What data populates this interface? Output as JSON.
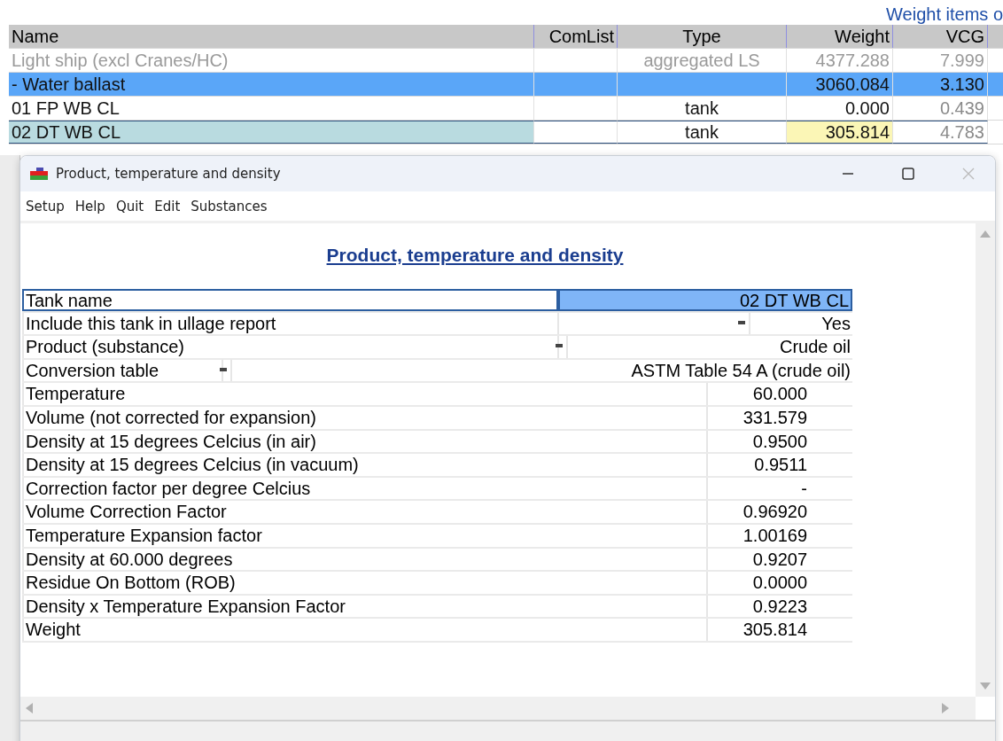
{
  "background": {
    "caption": "Weight items o",
    "columns": [
      "Name",
      "ComList",
      "Type",
      "Weight",
      "VCG"
    ],
    "rows": [
      {
        "kind": "aggregate",
        "selected": false,
        "cells": [
          "Light ship (excl Cranes/HC)",
          "",
          "aggregated LS",
          "4377.288",
          "7.999"
        ]
      },
      {
        "kind": "group",
        "selected": false,
        "cells": [
          "- Water ballast",
          "",
          "",
          "3060.084",
          "3.130"
        ]
      },
      {
        "kind": "item",
        "selected": false,
        "cells": [
          "01 FP WB  CL",
          "",
          "tank",
          "0.000",
          "0.439"
        ]
      },
      {
        "kind": "item",
        "selected": true,
        "cells": [
          "02 DT WB CL",
          "",
          "tank",
          "305.814",
          "4.783"
        ]
      }
    ]
  },
  "dialog": {
    "title": "Product, temperature and density",
    "menu": [
      "Setup",
      "Help",
      "Quit",
      "Edit",
      "Substances"
    ],
    "heading": "Product, temperature and density",
    "rows": [
      {
        "kind": "name",
        "selected": true,
        "dropdown": false,
        "label": "Tank name",
        "value": "02 DT WB CL"
      },
      {
        "kind": "choice",
        "selected": false,
        "dropdown": true,
        "label": "Include this tank in ullage report",
        "value": "Yes"
      },
      {
        "kind": "medium",
        "selected": false,
        "dropdown": true,
        "label": "Product (substance)",
        "value": "Crude oil"
      },
      {
        "kind": "wide",
        "selected": false,
        "dropdown": true,
        "label": "Conversion table",
        "value": "ASTM Table 54 A (crude oil)"
      },
      {
        "kind": "number",
        "selected": false,
        "dropdown": false,
        "label": "Temperature",
        "value": "60.000"
      },
      {
        "kind": "number",
        "selected": false,
        "dropdown": false,
        "label": "Volume (not corrected for expansion)",
        "value": "331.579"
      },
      {
        "kind": "number",
        "selected": false,
        "dropdown": false,
        "label": "Density at 15 degrees Celcius (in air)",
        "value": "0.9500"
      },
      {
        "kind": "number",
        "selected": false,
        "dropdown": false,
        "label": "Density at 15 degrees Celcius (in vacuum)",
        "value": "0.9511"
      },
      {
        "kind": "number",
        "selected": false,
        "dropdown": false,
        "label": "Correction factor per degree Celcius",
        "value": "-"
      },
      {
        "kind": "number",
        "selected": false,
        "dropdown": false,
        "label": "Volume Correction Factor",
        "value": "0.96920"
      },
      {
        "kind": "number",
        "selected": false,
        "dropdown": false,
        "label": "Temperature Expansion factor",
        "value": "1.00169"
      },
      {
        "kind": "number",
        "selected": false,
        "dropdown": false,
        "label": "Density at 60.000 degrees",
        "value": "0.9207"
      },
      {
        "kind": "number",
        "selected": false,
        "dropdown": false,
        "label": "Residue On Bottom (ROB)",
        "value": "0.0000"
      },
      {
        "kind": "number",
        "selected": false,
        "dropdown": false,
        "label": "Density x Temperature Expansion Factor",
        "value": "0.9223"
      },
      {
        "kind": "number",
        "selected": false,
        "dropdown": false,
        "label": "Weight",
        "value": "305.814"
      }
    ]
  }
}
